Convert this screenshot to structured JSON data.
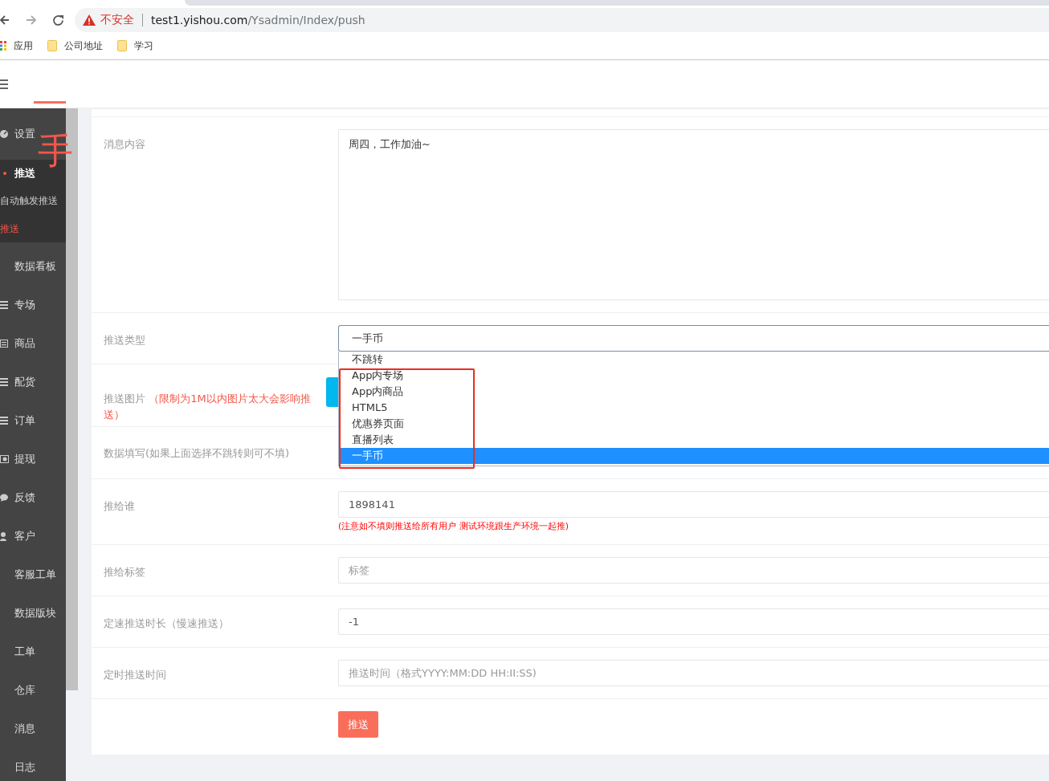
{
  "browser": {
    "address": {
      "security_label": "不安全",
      "host": "test1.yishou.com",
      "path": "/Ysadmin/Index/push"
    },
    "bookmarks": [
      {
        "kind": "apps",
        "label": "应用"
      },
      {
        "kind": "folder",
        "label": "公司地址"
      },
      {
        "kind": "folder",
        "label": "学习"
      }
    ]
  },
  "sidebar": {
    "items": [
      {
        "label": "设置",
        "kind": "gauge",
        "expanded": false
      },
      {
        "label": "推送",
        "kind": "dot",
        "expanded": true,
        "children": [
          {
            "label": "自动触发推送",
            "selected": false
          },
          {
            "label": "推送",
            "selected": true
          }
        ]
      },
      {
        "label": "数据看板",
        "kind": "plain",
        "expanded": false
      },
      {
        "label": "专场",
        "kind": "list",
        "expanded": false
      },
      {
        "label": "商品",
        "kind": "card",
        "expanded": false
      },
      {
        "label": "配货",
        "kind": "list",
        "expanded": false
      },
      {
        "label": "订单",
        "kind": "list",
        "expanded": false
      },
      {
        "label": "提现",
        "kind": "money",
        "expanded": false
      },
      {
        "label": "反馈",
        "kind": "chat",
        "expanded": false
      },
      {
        "label": "客户",
        "kind": "user",
        "expanded": false
      },
      {
        "label": "客服工单",
        "kind": "plain",
        "expanded": false
      },
      {
        "label": "数据版块",
        "kind": "plain",
        "expanded": false
      },
      {
        "label": "工单",
        "kind": "plain",
        "expanded": false
      },
      {
        "label": "仓库",
        "kind": "plain",
        "expanded": false
      },
      {
        "label": "消息",
        "kind": "plain",
        "expanded": false
      },
      {
        "label": "日志",
        "kind": "plain",
        "expanded": false
      }
    ]
  },
  "form": {
    "rows": [
      {
        "kind": "textarea",
        "label": "消息内容",
        "value": "周四，工作加油~"
      },
      {
        "kind": "select",
        "label": "推送类型",
        "value": "一手币",
        "options": [
          {
            "label": "不跳转",
            "selected": false
          },
          {
            "label": "App内专场",
            "selected": false
          },
          {
            "label": "App内商品",
            "selected": false
          },
          {
            "label": "HTML5",
            "selected": false
          },
          {
            "label": "优惠券页面",
            "selected": false
          },
          {
            "label": "直播列表",
            "selected": false
          },
          {
            "label": "一手币",
            "selected": true
          }
        ]
      },
      {
        "kind": "upload",
        "label": "推送图片",
        "note": "（限制为1M以内图片太大会影响推送）"
      },
      {
        "kind": "hidden",
        "label": "数据填写(如果上面选择不跳转则可不填)"
      },
      {
        "kind": "input",
        "label": "推给谁",
        "value": "1898141",
        "note": "(注意如不填则推送给所有用户 测试环境跟生产环境一起推)"
      },
      {
        "kind": "input",
        "label": "推给标签",
        "placeholder": "标签"
      },
      {
        "kind": "input",
        "label": "定速推送时长（慢速推送）",
        "value": "-1"
      },
      {
        "kind": "input",
        "label": "定时推送时间",
        "placeholder": "推送时间（格式YYYY:MM:DD HH:II:SS)"
      },
      {
        "kind": "submit",
        "label": "推送"
      }
    ]
  },
  "annotation": {
    "text": "手"
  }
}
